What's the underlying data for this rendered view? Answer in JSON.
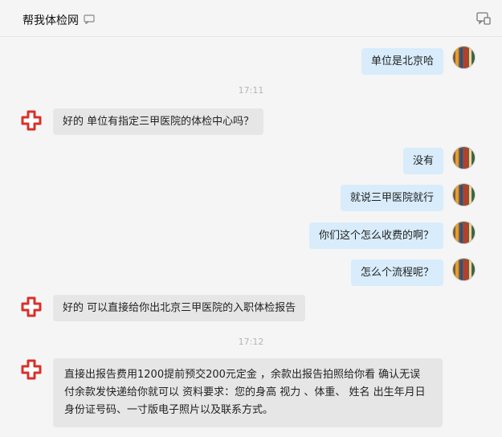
{
  "header": {
    "title": "帮我体检网"
  },
  "messages": [
    {
      "side": "out",
      "text": "单位是北京哈"
    },
    {
      "timestamp": "17:11"
    },
    {
      "side": "in",
      "text": "好的  单位有指定三甲医院的体检中心吗？"
    },
    {
      "side": "out",
      "text": "没有"
    },
    {
      "side": "out",
      "text": "就说三甲医院就行"
    },
    {
      "side": "out",
      "text": "你们这个怎么收费的啊？"
    },
    {
      "side": "out",
      "text": "怎么个流程呢？"
    },
    {
      "side": "in",
      "text": "好的 可以直接给你出北京三甲医院的入职体检报告"
    },
    {
      "timestamp": "17:12"
    },
    {
      "side": "in",
      "text": "直接出报告费用1200提前预交200元定金 ，余款出报告拍照给你看 确认无误 付余款发快递给你就可以 资料要求：您的身高 视力 、体重、 姓名 出生年月日 身份证号码、一寸版电子照片以及联系方式。"
    }
  ],
  "colors": {
    "incoming_bubble": "#e6e6e6",
    "outgoing_bubble": "#d8ecfb",
    "cross_red": "#d9302a",
    "timestamp": "#b5b5b5"
  },
  "icons": {
    "incoming_avatar": "red-cross-icon",
    "outgoing_avatar": "user-avatar",
    "title_icon": "chat-bubble-icon",
    "top_right": "chat-window-icon"
  }
}
